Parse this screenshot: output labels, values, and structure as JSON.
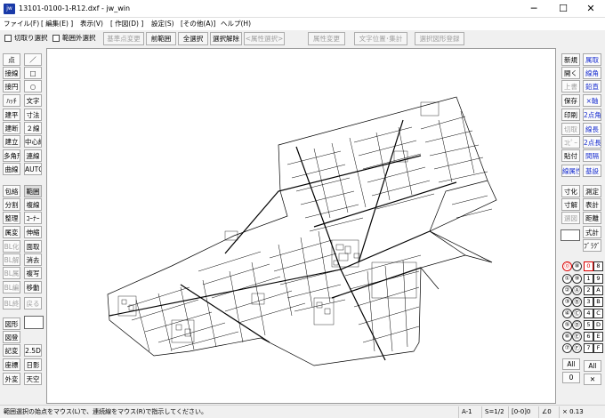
{
  "window": {
    "title": "13101-0100-1-R12.dxf - jw_win",
    "app_icon": "jw"
  },
  "menu": [
    "ファイル(F)",
    "[ 編集(E) ]",
    "表示(V)",
    "[ 作図(D) ]",
    "設定(S)",
    "[その他(A)]",
    "ヘルプ(H)"
  ],
  "toolbar": {
    "check1": "切取り選択",
    "check2": "範囲外選択",
    "buttons": [
      "基準点変更",
      "前範囲",
      "全選択",
      "選択解除",
      "<属性選択>",
      "属性変更",
      "文字位置･集計",
      "選択図形登録"
    ]
  },
  "left_tools": [
    [
      "点",
      "／"
    ],
    [
      "接線",
      "□"
    ],
    [
      "接円",
      "○"
    ],
    [
      "ﾊｯﾁ",
      "文字"
    ],
    [
      "建平",
      "寸法"
    ],
    [
      "建断",
      "２線"
    ],
    [
      "建立",
      "中心線"
    ],
    [
      "多角形",
      "連線"
    ],
    [
      "曲線",
      "AUTO"
    ],
    [
      "包絡",
      "範囲"
    ],
    [
      "分割",
      "複線"
    ],
    [
      "整理",
      "ｺｰﾅｰ"
    ],
    [
      "属変",
      "伸縮"
    ],
    [
      "BL化",
      "面取"
    ],
    [
      "BL解",
      "消去"
    ],
    [
      "BL属",
      "複写"
    ],
    [
      "BL編",
      "移動"
    ],
    [
      "BL終",
      "戻る"
    ],
    [
      "図形",
      ""
    ],
    [
      "図登",
      ""
    ],
    [
      "記変",
      "2.5D"
    ],
    [
      "座標",
      "日影"
    ],
    [
      "外変",
      "天空"
    ]
  ],
  "right_tools": [
    [
      "新規",
      "属取"
    ],
    [
      "開く",
      "線角"
    ],
    [
      "上書",
      "鉛直"
    ],
    [
      "保存",
      "×軸"
    ],
    [
      "印刷",
      "2点角"
    ],
    [
      "切取",
      "線長"
    ],
    [
      "ｺﾋﾟｰ",
      "2点長"
    ],
    [
      "貼付",
      "間隔"
    ],
    [
      "",
      ""
    ],
    [
      "測定",
      ""
    ],
    [
      "寸化",
      "測定"
    ],
    [
      "寸解",
      "表計"
    ],
    [
      "選図",
      "距離"
    ],
    [
      "",
      "式計"
    ],
    [
      "",
      "ﾌﾞﾗｸﾞ"
    ]
  ],
  "right_extra": {
    "layer_sel": "線属性",
    "blue_btn": "基設"
  },
  "layer_group": {
    "rows": [
      [
        "⓪",
        "⑧",
        "0",
        "8"
      ],
      [
        "①",
        "⑨",
        "1",
        "9"
      ],
      [
        "②",
        "Ⓐ",
        "2",
        "A"
      ],
      [
        "③",
        "Ⓑ",
        "3",
        "B"
      ],
      [
        "④",
        "Ⓒ",
        "4",
        "C"
      ],
      [
        "⑤",
        "Ⓓ",
        "5",
        "D"
      ],
      [
        "⑥",
        "Ⓔ",
        "6",
        "E"
      ],
      [
        "⑦",
        "Ⓕ",
        "7",
        "F"
      ]
    ],
    "all1": "All",
    "all2": "All",
    "zero1": "0",
    "x_label": "✕"
  },
  "status": {
    "message": "範囲選択の始点をマウス(L)で、連続線をマウス(R)で指示してください。",
    "scale_layer": "A-1",
    "scale": "S=1/2",
    "layer": "[0-0]0",
    "angle": "∠0",
    "zoom": "× 0.13"
  },
  "colors": {
    "title_bg": "#ffffff",
    "canvas_bg": "#ffffff",
    "accent_blue": "#1a2fd0"
  }
}
